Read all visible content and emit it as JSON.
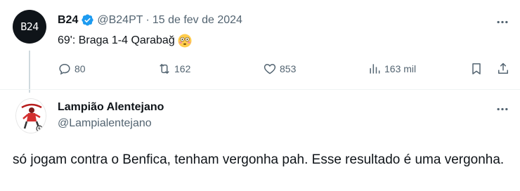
{
  "quoted_tweet": {
    "avatar_text": "B24",
    "display_name": "B24",
    "handle": "@B24PT",
    "separator": "·",
    "date": "15 de fev de 2024",
    "text": "69': Braga 1-4 Qarabağ",
    "emoji": "flushed-face-icon",
    "actions": {
      "replies": "80",
      "retweets": "162",
      "likes": "853",
      "views": "163 mil"
    }
  },
  "reply_tweet": {
    "display_name": "Lampião Alentejano",
    "handle": "@Lampialentejano",
    "text": "só jogam contra o Benfica, tenham vergonha pah. Esse resultado é uma vergonha."
  },
  "colors": {
    "text_primary": "#0f1419",
    "text_secondary": "#536471",
    "verified_blue": "#1d9bf0",
    "divider": "#eff3f4"
  }
}
